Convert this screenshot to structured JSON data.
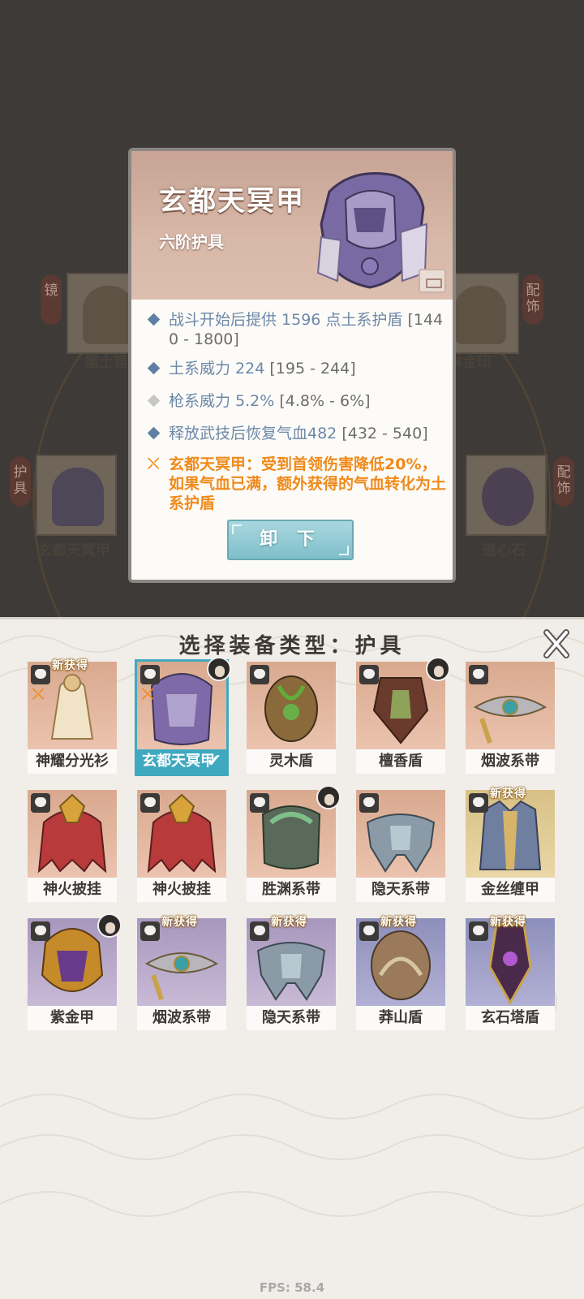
{
  "detail": {
    "name": "玄都天冥甲",
    "grade": "六阶护具",
    "stats": [
      {
        "text": "战斗开始后提供 1596 点土系护盾 ",
        "range": "[1440 - 1800]",
        "icon": "blue-diamond-icon"
      },
      {
        "text": "土系威力 224 ",
        "range": "[195 - 244]",
        "icon": "blue-diamond-icon"
      },
      {
        "text": "枪系威力 5.2% ",
        "range": "[4.8% - 6%]",
        "icon": "gray-diamond-icon"
      },
      {
        "text": "释放武技后恢复气血482 ",
        "range": "[432 - 540]",
        "icon": "blue-diamond-icon"
      }
    ],
    "special": "玄都天冥甲：受到首领伤害降低20%，如果气血已满，额外获得的气血转化为土系护盾",
    "unequip_label": "卸 下"
  },
  "background": {
    "left_tag_top": "镜",
    "right_tag_top": "配饰",
    "left_tag_bottom": "护具",
    "right_tag_bottom": "配饰",
    "label_left_top": "重土锤",
    "label_right_top": "琳金印",
    "label_left_bottom": "玄都天冥甲",
    "label_right_bottom": "道心石"
  },
  "panel": {
    "title": "选择装备类型：护具",
    "close_icon": "close-x-icon",
    "new_badge": "新获得",
    "items": [
      {
        "name": "神耀分光衫",
        "bg": "peach",
        "new": true,
        "equipped_icon": true,
        "avatar": false,
        "selected": false
      },
      {
        "name": "玄都天冥甲",
        "bg": "peach",
        "new": false,
        "equipped_icon": true,
        "avatar": true,
        "selected": true
      },
      {
        "name": "灵木盾",
        "bg": "peach",
        "new": false,
        "equipped_icon": false,
        "avatar": false,
        "selected": false
      },
      {
        "name": "檀香盾",
        "bg": "peach",
        "new": false,
        "equipped_icon": false,
        "avatar": true,
        "selected": false
      },
      {
        "name": "烟波系带",
        "bg": "peach",
        "new": false,
        "equipped_icon": false,
        "avatar": false,
        "selected": false
      },
      {
        "name": "神火披挂",
        "bg": "peach",
        "new": false,
        "equipped_icon": false,
        "avatar": false,
        "selected": false
      },
      {
        "name": "神火披挂",
        "bg": "peach",
        "new": false,
        "equipped_icon": false,
        "avatar": false,
        "selected": false
      },
      {
        "name": "胜渊系带",
        "bg": "peach",
        "new": false,
        "equipped_icon": false,
        "avatar": true,
        "selected": false
      },
      {
        "name": "隐天系带",
        "bg": "peach",
        "new": false,
        "equipped_icon": false,
        "avatar": false,
        "selected": false
      },
      {
        "name": "金丝缠甲",
        "bg": "gold",
        "new": true,
        "equipped_icon": false,
        "avatar": false,
        "selected": false
      },
      {
        "name": "紫金甲",
        "bg": "lilac",
        "new": false,
        "equipped_icon": false,
        "avatar": true,
        "selected": false
      },
      {
        "name": "烟波系带",
        "bg": "lilac",
        "new": true,
        "equipped_icon": false,
        "avatar": false,
        "selected": false
      },
      {
        "name": "隐天系带",
        "bg": "lilac",
        "new": true,
        "equipped_icon": false,
        "avatar": false,
        "selected": false
      },
      {
        "name": "莽山盾",
        "bg": "blue",
        "new": true,
        "equipped_icon": false,
        "avatar": false,
        "selected": false
      },
      {
        "name": "玄石塔盾",
        "bg": "blue",
        "new": true,
        "equipped_icon": false,
        "avatar": false,
        "selected": false
      }
    ]
  },
  "fps": "FPS: 58.4",
  "colors": {
    "selected": "#3fa9c0",
    "special_text": "#f08a1a",
    "stat_text": "#6c88a7"
  }
}
